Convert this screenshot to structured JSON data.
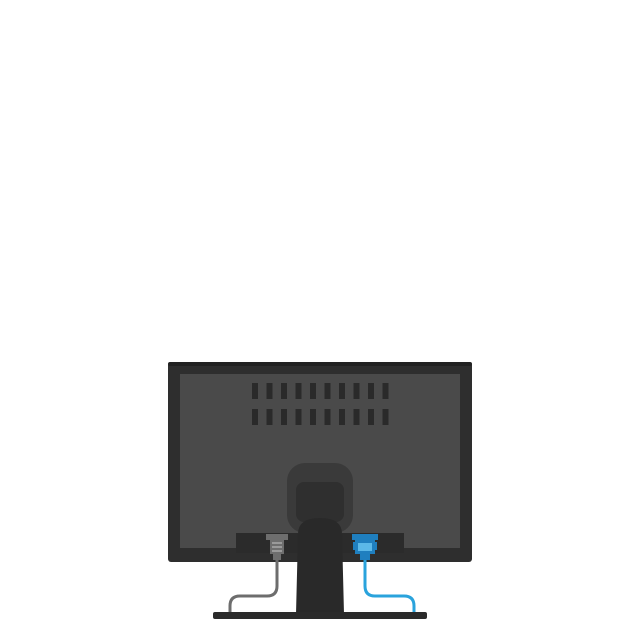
{
  "scene": {
    "subject": "monitor-rear-view",
    "colors": {
      "background": "#ffffff",
      "body_outer": "#2e2e2e",
      "body_top_edge": "#222222",
      "body_panel": "#4a4a4a",
      "vent_slot": "#2a2a2a",
      "stand_neck": "#292929",
      "stand_mount_ring": "#3a3a3a",
      "stand_mount_inner": "#2f2f2f",
      "port_bay": "#2b2b2b",
      "power_plug": "#6e6e6e",
      "power_plug_detail": "#9a9a9a",
      "power_cable": "#6d6d6d",
      "vga_plug": "#1f7fbf",
      "vga_plug_detail": "#5bb8e8",
      "vga_cable": "#2aa3dc",
      "base": "#2b2b2b"
    },
    "vent_rows": 2,
    "vent_columns": 10,
    "icons": [
      "power-plug-icon",
      "vga-connector-icon"
    ]
  }
}
